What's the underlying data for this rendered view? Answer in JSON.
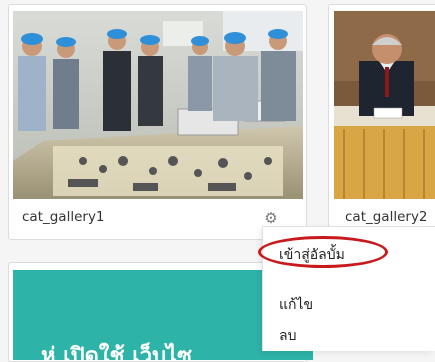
{
  "gallery": {
    "items": [
      {
        "caption": "cat_gallery1",
        "settings_icon": "gear-icon"
      },
      {
        "caption": "cat_gallery2"
      }
    ],
    "banner_text": "ห่ เปิดใช้ เว็บไซ"
  },
  "context_menu": {
    "items": [
      {
        "label": "เข้าสู่อัลบั้ม",
        "highlighted": true
      },
      {
        "label": "แก้ไข"
      },
      {
        "label": "ลบ"
      }
    ]
  },
  "colors": {
    "banner": "#2db3a8",
    "highlight_ring": "#c8191c",
    "page_bg": "#f5f5f5"
  }
}
